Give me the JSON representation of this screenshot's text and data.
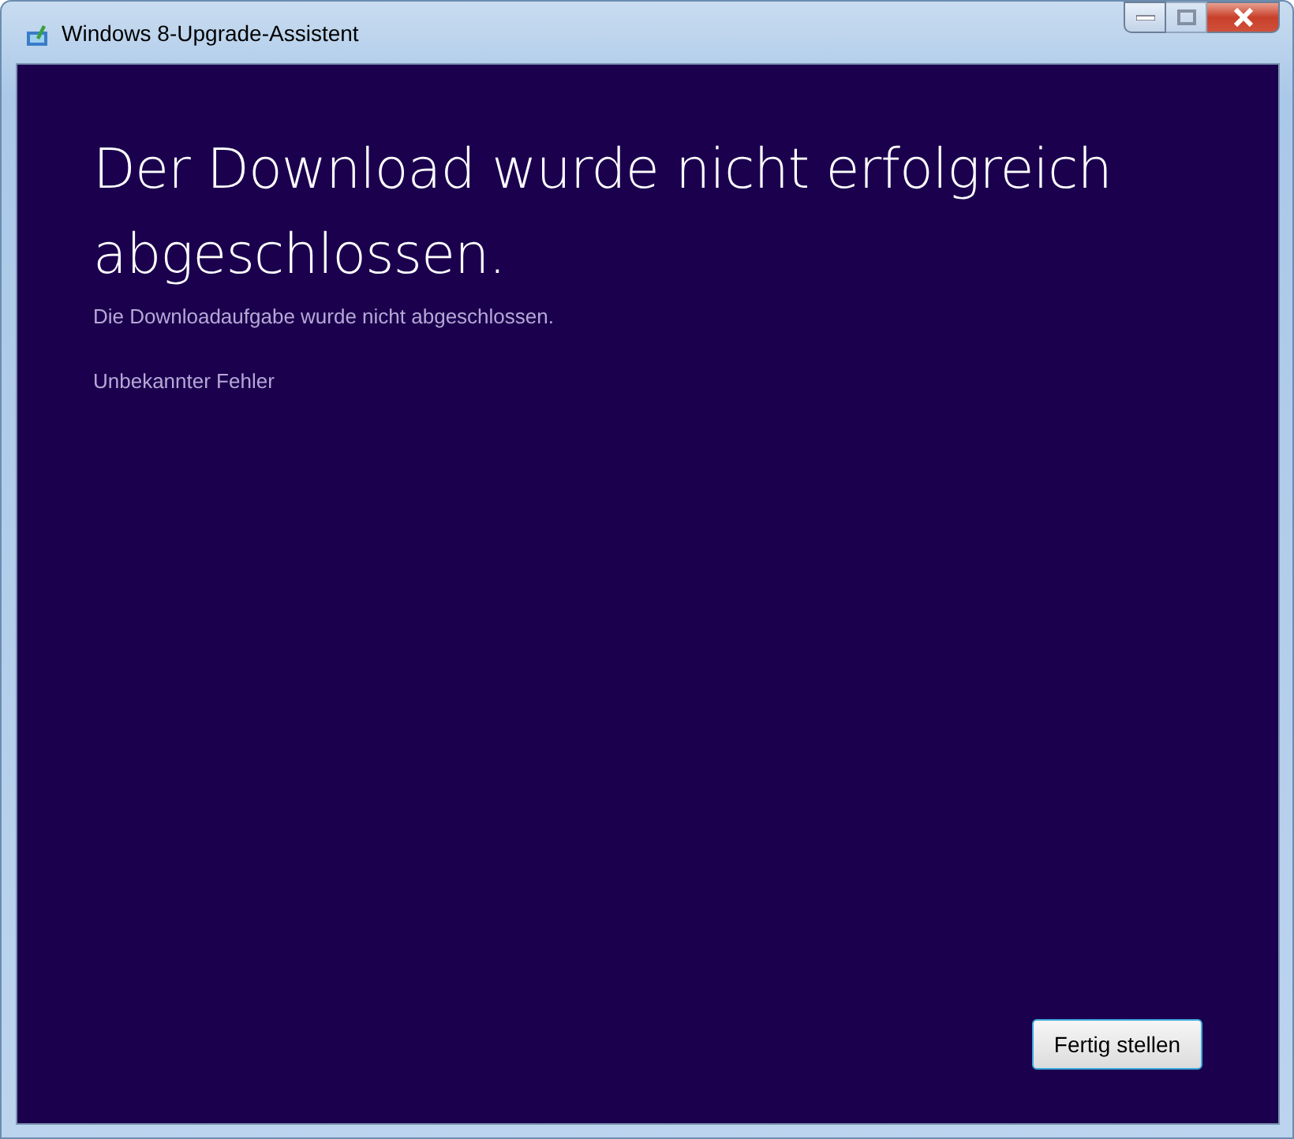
{
  "window": {
    "title": "Windows 8-Upgrade-Assistent",
    "maximize_disabled": true
  },
  "heading": "Der Download wurde nicht erfolgreich abgeschlossen.",
  "subtitle": "Die Downloadaufgabe wurde nicht abgeschlossen.",
  "error": "Unbekannter Fehler",
  "buttons": [
    {
      "label": "Fertig stellen"
    }
  ]
}
